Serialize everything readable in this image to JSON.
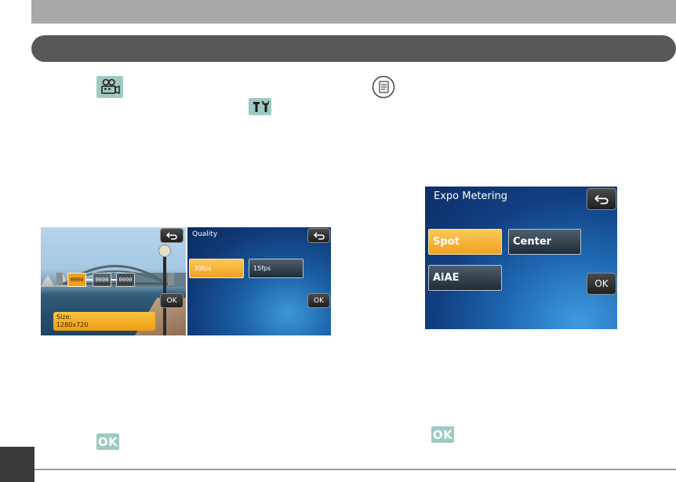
{
  "page": {
    "icons": {
      "movie_mode": "movie-camera-icon",
      "setup_menu": "setup-tools-icon",
      "note": "note-icon",
      "ok_key": "OK"
    },
    "colors": {
      "header_band": "#a9a9a9",
      "section_pill": "#575757",
      "inline_icon_bg": "#9fc9c3",
      "selected_option": "#f1a022"
    }
  },
  "screen_video_size": {
    "options": [
      "0000",
      "0000",
      "0000"
    ],
    "selected_index": 0,
    "size_label": "Size:",
    "size_value": "1280x720",
    "ok_label": "OK"
  },
  "screen_quality": {
    "title": "Quality",
    "options": [
      "30fps",
      "15fps"
    ],
    "selected": "30fps",
    "ok_label": "OK"
  },
  "screen_expo_metering": {
    "title": "Expo Metering",
    "options": [
      "Spot",
      "Center",
      "AiAE"
    ],
    "selected": "Spot",
    "ok_label": "OK"
  }
}
